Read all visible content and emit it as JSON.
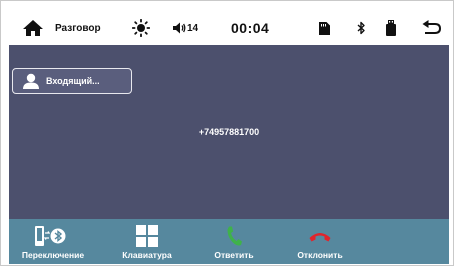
{
  "status_bar": {
    "title": "Разговор",
    "volume": "14",
    "time": "00:04",
    "icons": [
      "home-icon",
      "brightness-icon",
      "volume-icon",
      "sd-card-icon",
      "bluetooth-icon",
      "usb-icon",
      "back-icon"
    ]
  },
  "call": {
    "caller_label": "Входящий...",
    "phone_number": "+74957881700"
  },
  "bottom_bar": {
    "switch_label": "Переключение",
    "keypad_label": "Клавиатура",
    "answer_label": "Ответить",
    "decline_label": "Отклонить"
  },
  "colors": {
    "main_bg": "#4c506d",
    "bottom_bg": "#56889e",
    "answer_green": "#3fb24a",
    "decline_red": "#e0242c"
  }
}
